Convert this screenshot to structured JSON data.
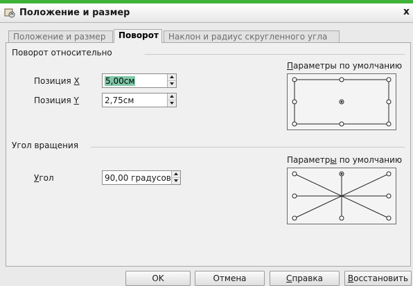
{
  "window": {
    "title": "Положение и размер",
    "close_glyph": "x"
  },
  "tabs": [
    {
      "label": "Положение и размер"
    },
    {
      "label": "Поворот"
    },
    {
      "label": "Наклон и радиус скругленного угла"
    }
  ],
  "pivot": {
    "section_title": "Поворот относительно",
    "pos_x": {
      "label_prefix": "Позиция ",
      "label_key": "X",
      "value": "5,00см"
    },
    "pos_y": {
      "label_prefix": "Позиция ",
      "label_key": "Y",
      "value": "2,75см"
    },
    "defaults_label": {
      "before": "",
      "key": "П",
      "after": "араметры по умолчанию"
    }
  },
  "rotation": {
    "section_title": "Угол вращения",
    "angle": {
      "label_key": "У",
      "label_rest": "гол",
      "value": "90,00 градусов"
    },
    "defaults_label": {
      "before": "Параметр",
      "key": "ы",
      "after": " по умолчанию"
    }
  },
  "buttons": {
    "ok": "OK",
    "cancel": "Отмена",
    "help": {
      "key": "С",
      "rest": "правка"
    },
    "reset": {
      "key": "В",
      "rest": "осстановить"
    }
  }
}
